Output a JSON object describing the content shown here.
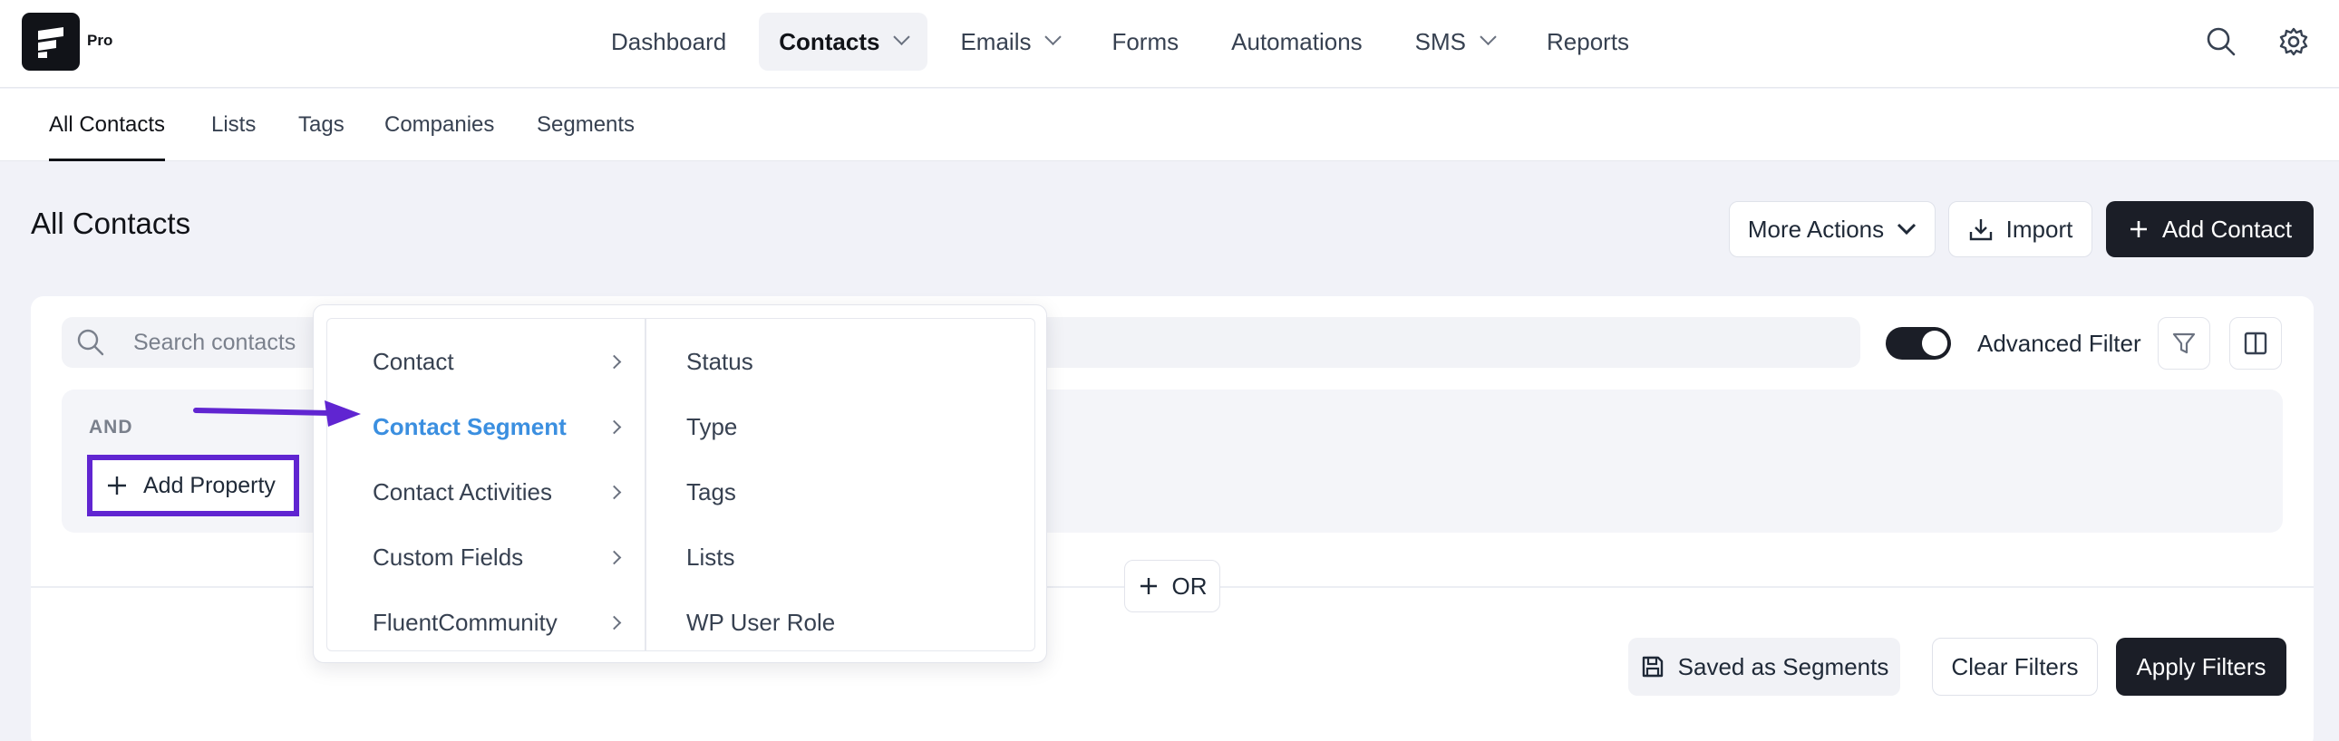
{
  "brand": {
    "badge": "Pro"
  },
  "topnav": {
    "items": [
      {
        "label": "Dashboard"
      },
      {
        "label": "Contacts"
      },
      {
        "label": "Emails"
      },
      {
        "label": "Forms"
      },
      {
        "label": "Automations"
      },
      {
        "label": "SMS"
      },
      {
        "label": "Reports"
      }
    ],
    "icons": [
      "search-icon",
      "gear-icon"
    ]
  },
  "subnav": {
    "items": [
      {
        "label": "All Contacts"
      },
      {
        "label": "Lists"
      },
      {
        "label": "Tags"
      },
      {
        "label": "Companies"
      },
      {
        "label": "Segments"
      }
    ]
  },
  "page": {
    "title": "All Contacts",
    "more_actions": "More Actions",
    "import": "Import",
    "add_contact": "Add Contact"
  },
  "search": {
    "placeholder": "Search contacts"
  },
  "filter": {
    "advanced_label": "Advanced Filter",
    "advanced_on": true,
    "and_label": "AND",
    "add_property": "Add Property",
    "or_label": "OR",
    "saved_segments": "Saved as Segments",
    "clear_filters": "Clear Filters",
    "apply_filters": "Apply Filters"
  },
  "dropdown": {
    "groups": [
      {
        "label": "Contact"
      },
      {
        "label": "Contact Segment"
      },
      {
        "label": "Contact Activities"
      },
      {
        "label": "Custom Fields"
      },
      {
        "label": "FluentCommunity"
      }
    ],
    "options": [
      {
        "label": "Status"
      },
      {
        "label": "Type"
      },
      {
        "label": "Tags"
      },
      {
        "label": "Lists"
      },
      {
        "label": "WP User Role"
      }
    ]
  },
  "colors": {
    "accent_purple": "#6025d1",
    "active_blue": "#3b8fe0",
    "dark": "#1b1e27"
  }
}
